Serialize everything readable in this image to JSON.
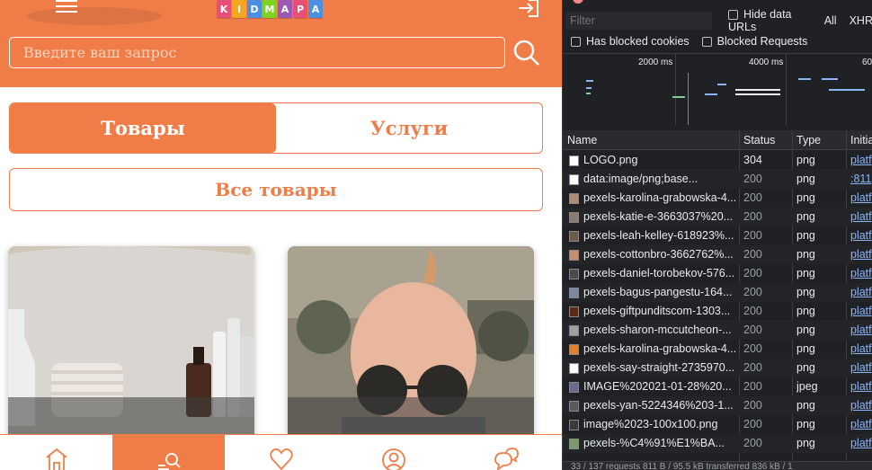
{
  "app": {
    "logo_letters": [
      "K",
      "I",
      "D",
      "M",
      "A",
      "P",
      "A"
    ],
    "logo_colors": [
      "#e94e77",
      "#f5a623",
      "#4a90e2",
      "#7ed321",
      "#9b59b6",
      "#e94e77",
      "#4a90e2"
    ],
    "search_placeholder": "Введите ваш запрос",
    "tabs": [
      {
        "label": "Товары",
        "active": true
      },
      {
        "label": "Услуги",
        "active": false
      }
    ],
    "all_goods_label": "Все товары",
    "accent_color": "#f07d48",
    "bottom_nav": [
      {
        "icon": "home-icon",
        "active": false
      },
      {
        "icon": "catalog-search-icon",
        "active": true
      },
      {
        "icon": "heart-icon",
        "active": false
      },
      {
        "icon": "user-icon",
        "active": false
      },
      {
        "icon": "chat-icon",
        "active": false
      }
    ]
  },
  "devtools": {
    "filter_placeholder": "Filter",
    "hide_data_urls_label": "Hide data URLs",
    "all_label": "All",
    "xhr_label": "XHR",
    "has_blocked_cookies_label": "Has blocked cookies",
    "blocked_requests_label": "Blocked Requests",
    "timeline_labels": [
      "2000 ms",
      "4000 ms",
      "60"
    ],
    "columns": {
      "name": "Name",
      "status": "Status",
      "type": "Type",
      "initiator": "Initia"
    },
    "rows": [
      {
        "name": "LOGO.png",
        "status": "304",
        "type": "png",
        "initiator": "platf",
        "icon_color": "#ffffff"
      },
      {
        "name": "data:image/png;base...",
        "status": "200",
        "type": "png",
        "initiator": ":811",
        "icon_color": "#ffffff"
      },
      {
        "name": "pexels-karolina-grabowska-4...",
        "status": "200",
        "type": "png",
        "initiator": "platf",
        "icon_color": "#b08d7a"
      },
      {
        "name": "pexels-katie-e-3663037%20...",
        "status": "200",
        "type": "png",
        "initiator": "platf",
        "icon_color": "#8a7a70"
      },
      {
        "name": "pexels-leah-kelley-618923%...",
        "status": "200",
        "type": "png",
        "initiator": "platf",
        "icon_color": "#6e5a4a"
      },
      {
        "name": "pexels-cottonbro-3662762%...",
        "status": "200",
        "type": "png",
        "initiator": "platf",
        "icon_color": "#c49070"
      },
      {
        "name": "pexels-daniel-torobekov-576...",
        "status": "200",
        "type": "png",
        "initiator": "platf",
        "icon_color": "#4a4a4a"
      },
      {
        "name": "pexels-bagus-pangestu-164...",
        "status": "200",
        "type": "png",
        "initiator": "platf",
        "icon_color": "#7a8aa0"
      },
      {
        "name": "pexels-giftpunditscom-1303...",
        "status": "200",
        "type": "png",
        "initiator": "platf",
        "icon_color": "#5a2a1a"
      },
      {
        "name": "pexels-sharon-mccutcheon-...",
        "status": "200",
        "type": "png",
        "initiator": "platf",
        "icon_color": "#a0a0a0"
      },
      {
        "name": "pexels-karolina-grabowska-4...",
        "status": "200",
        "type": "png",
        "initiator": "platf",
        "icon_color": "#e08030"
      },
      {
        "name": "pexels-say-straight-2735970...",
        "status": "200",
        "type": "png",
        "initiator": "platf",
        "icon_color": "#ffffff"
      },
      {
        "name": "IMAGE%202021-01-28%20...",
        "status": "200",
        "type": "jpeg",
        "initiator": "platf",
        "icon_color": "#6a6a8a"
      },
      {
        "name": "pexels-yan-5224346%203-1...",
        "status": "200",
        "type": "png",
        "initiator": "platf",
        "icon_color": "#5a5a5a"
      },
      {
        "name": "image%2023-100x100.png",
        "status": "200",
        "type": "png",
        "initiator": "platf",
        "icon_color": "#3a3a3a"
      },
      {
        "name": "pexels-%C4%91%E1%BA...",
        "status": "200",
        "type": "png",
        "initiator": "platf",
        "icon_color": "#7a9a6a"
      }
    ],
    "footer": "33 / 137 requests   811 B / 95.5 kB transferred   836 kB / 1"
  }
}
